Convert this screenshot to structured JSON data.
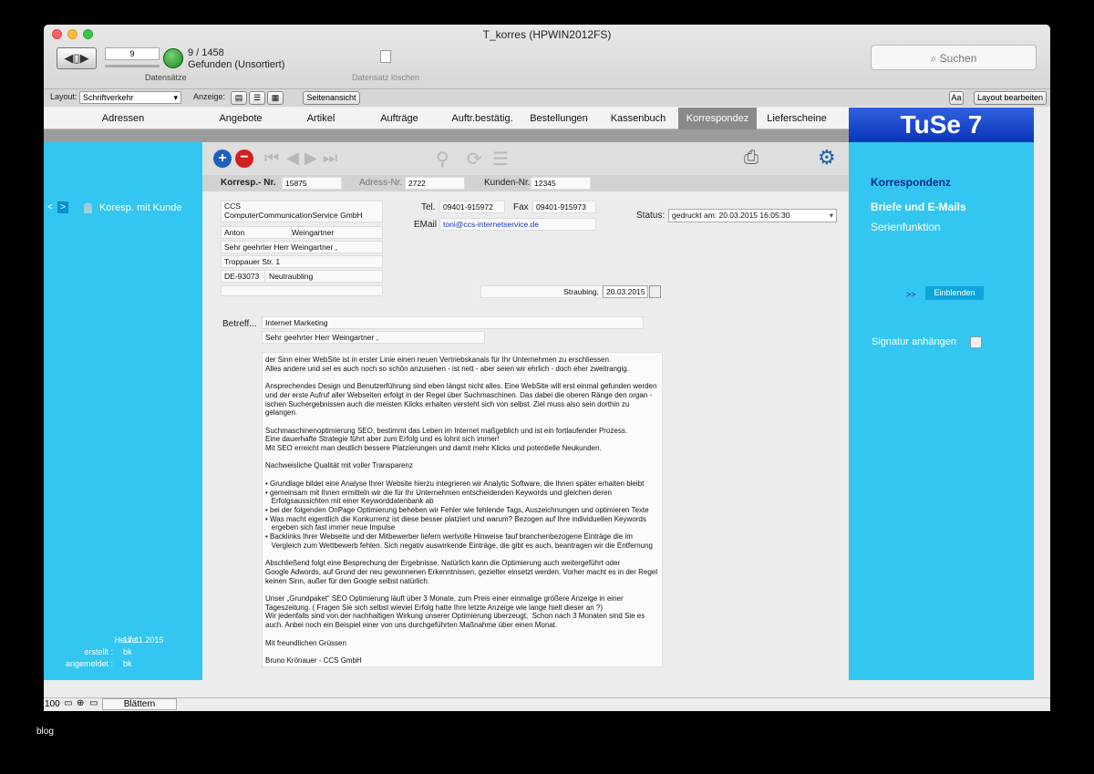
{
  "window": {
    "title": "T_korres (HPWIN2012FS)"
  },
  "toolbar": {
    "record_number": "9",
    "found": "9 / 1458",
    "found_state": "Gefunden (Unsortiert)",
    "records_label": "Datensätze",
    "delete_label": "Datensatz löschen",
    "search_placeholder": "Suchen"
  },
  "layoutbar": {
    "layout_label": "Layout:",
    "layout_value": "Schriftverkehr",
    "view_label": "Anzeige:",
    "page_view_button": "Seitenansicht",
    "edit_layout_button": "Layout bearbeiten"
  },
  "tabs": [
    {
      "label": "Adressen"
    },
    {
      "label": "Angebote"
    },
    {
      "label": "Artikel"
    },
    {
      "label": "Aufträge"
    },
    {
      "label": "Auftr.bestätig."
    },
    {
      "label": "Bestellungen"
    },
    {
      "label": "Kassenbuch"
    },
    {
      "label": "Korrespondez",
      "active": true
    },
    {
      "label": "Lieferscheine"
    }
  ],
  "logo": "TuSe 7",
  "left": {
    "nav_prev": "<",
    "nav_next": ">",
    "title": "Koresp. mit Kunde",
    "today_label": "Heute:",
    "today": "17.11.2015",
    "created_label": "erstellt :",
    "created": "bk",
    "logged_label": "angemeldet :",
    "logged": "bk"
  },
  "fields": {
    "korresp_label": "Korresp.- Nr.",
    "korresp": "15875",
    "adress_label": "Adress-Nr.",
    "adress": "2722",
    "kunden_label": "Kunden-Nr.",
    "kunden": "12345",
    "company1": "CCS",
    "company2": "ComputerCommunicationService GmbH",
    "firstname": "Anton",
    "lastname": "Weingartner",
    "salutation": "Sehr geehrter Herr  Weingartner ,",
    "street": "Troppauer Str. 1",
    "zip": "DE-93073",
    "city": "Neutraubling",
    "tel_label": "Tel.",
    "tel": "09401-915972",
    "fax_label": "Fax",
    "fax": "09401-915973",
    "email_label": "EMail",
    "email": "toni@ccs-internetservice.de",
    "status_label": "Status:",
    "status": "gedruckt am:  20.03.2015 16:05:30",
    "place": "Straubing,",
    "date": "20.03.2015",
    "subject_label": "Betreff...",
    "subject": "Internet Marketing",
    "greeting": "Sehr geehrter Herr  Weingartner ,",
    "body": "der Sinn einer WebSite ist in erster Linie einen neuen Vertriebskanals für Ihr Unternehmen zu erschliessen.\nAlles andere und sei es auch noch so schön anzusehen - ist nett - aber seien wir ehrlich - doch eher zweitrangig.\n\nAnsprechendes Design und Benutzerführung sind eben längst nicht alles. Eine WebSite will erst einmal gefunden werden\nund der erste Aufruf aller Webseiten erfolgt in der Regel über Suchmaschinen. Das dabei die oberen Ränge den organ -\nischen Suchergebnissen auch die meisten Klicks erhalten versteht sich von selbst. Ziel muss also sein dorthin zu\ngelangen.\n\nSuchmaschinenoptimierung SEO, bestimmt das Leben im Internet maßgeblich und ist ein fortlaufender Prozess.\nEine dauerhafte Strategie führt aber zum Erfolg und es lohnt sich immer!\nMit SEO erreicht man deutlich bessere Platzierungen und damit mehr Klicks und potentielle Neukunden.\n\nNachweisliche Qualität mit voller Transparenz\n\n• Grundlage bildet eine Analyse Ihrer Website hierzu integrieren wir Analytic Software, die Ihnen später erhalten bleibt\n• gemeinsam mit Ihnen ermitteln wir die für Ihr Unternehmen entscheidenden Keywords und gleichen deren\n   Erfolgsaussichten mit einer Keyworddatenbank ab\n• bei der folgenden OnPage Optimierung beheben wir Fehler wie fehlende Tags, Auszeichnungen und optimieren Texte\n• Was macht eigentlich die Konkurrenz ist diese besser platziert und warum? Bezogen auf Ihre individuellen Keywords\n   ergeben sich fast immer neue Impulse\n• Backlinks Ihrer Webseite und der Mitbewerber liefern wertvolle Hinweise fauf branchenbezogene Einträge die im\n   Vergleich zum Wettbewerb fehlen. Sich negativ auswirkende Einträge, die gibt es auch, beantragen wir die Entfernung\n\nAbschließend folgt eine Besprechung der Ergebnisse. Natürlich kann die Optimierung auch weitergeführt oder\nGoogle Adwords, auf Grund der neu gewonnenen Erkenntnissen, gezielter einsetzt werden. Vorher macht es in der Regel\nkeinen Sinn, außer für den Google selbst natürlich.\n\nUnser „Grundpaket“ SEO Optimierung läuft über 3 Monate, zum Preis einer einmalige größere Anzeige in einer\nTageszeitung. ( Fragen Sie sich selbst wieviel Erfolg hatte Ihre letzte Anzeige wie lange hielt dieser an ?)\nWir jedenfalls sind von der nachhaltigen Wirkung unserer Optimierung überzeugt,  Schon nach 3 Monaten sind Sie es\nauch. Anbei noch ein Beispiel einer von uns durchgeführten Maßnahme über einen Monat.\n\nMit freundlichen Grüssen\n\nBruno Krönauer - CCS GmbH"
  },
  "right": {
    "title": "Korrespondenz",
    "link1": "Briefe und E-Mails",
    "link2": "Serienfunktion",
    "arrows": ">>",
    "show_button": "Einblenden",
    "signature": "Signatur anhängen"
  },
  "status": {
    "zoom": "100",
    "mode": "Blättern"
  },
  "watermark": "blog",
  "colors": {
    "panel": "#33c6f0",
    "logo_bg": "#0a35b8",
    "add": "#1f5fc0",
    "remove": "#d42020",
    "gear": "#1f5fa8"
  }
}
